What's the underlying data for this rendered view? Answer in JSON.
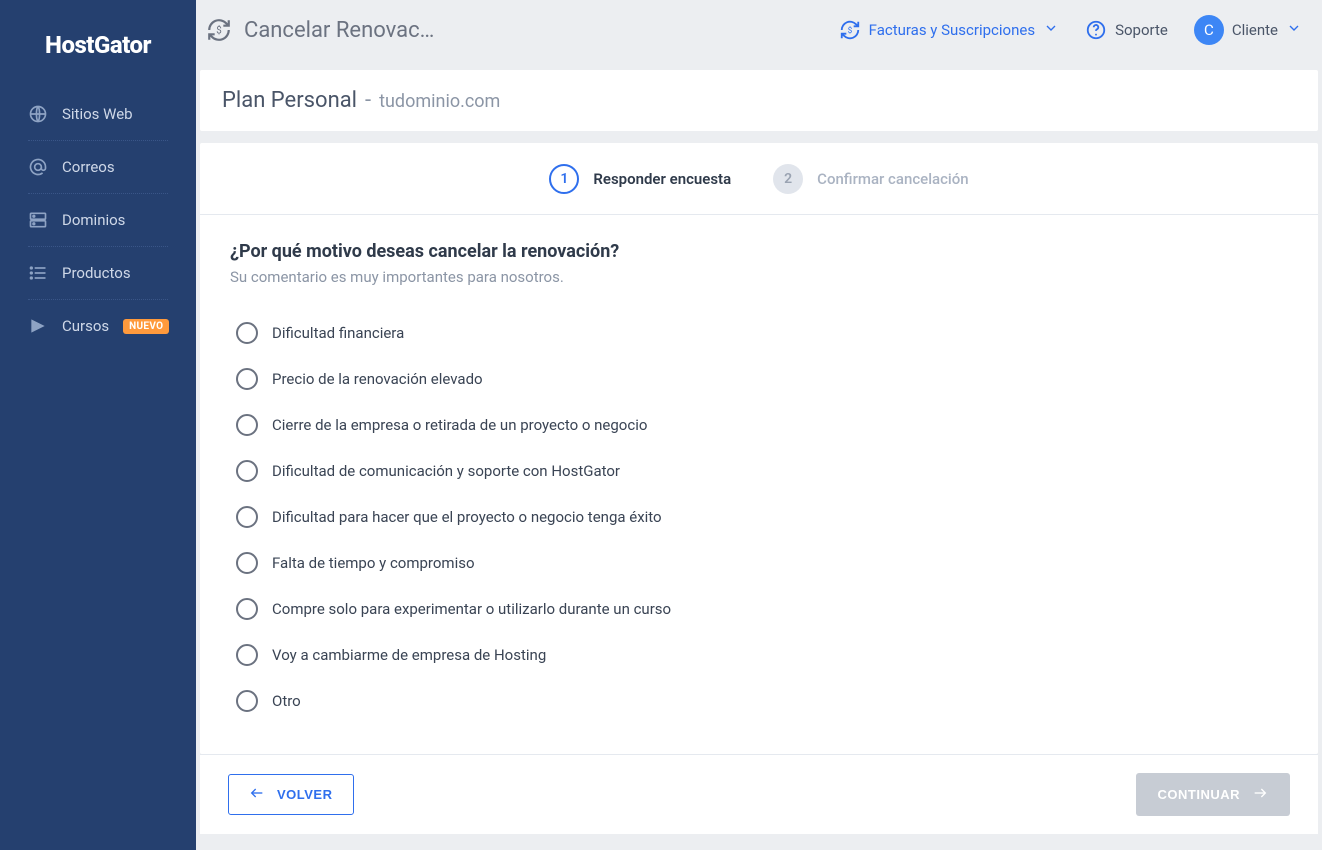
{
  "brand": "HostGator",
  "sidebar": {
    "items": [
      {
        "label": "Sitios Web"
      },
      {
        "label": "Correos"
      },
      {
        "label": "Dominios"
      },
      {
        "label": "Productos"
      },
      {
        "label": "Cursos",
        "badge": "NUEVO"
      }
    ]
  },
  "topbar": {
    "title": "Cancelar Renovac…",
    "links": {
      "invoices": "Facturas y Suscripciones",
      "support": "Soporte",
      "client": "Cliente"
    },
    "avatar_initial": "C"
  },
  "plan": {
    "name": "Plan Personal",
    "domain": "tudominio.com"
  },
  "stepper": {
    "step1": {
      "num": "1",
      "label": "Responder encuesta"
    },
    "step2": {
      "num": "2",
      "label": "Confirmar cancelación"
    }
  },
  "survey": {
    "question": "¿Por qué motivo deseas cancelar la renovación?",
    "subtitle": "Su comentario es muy importantes para nosotros.",
    "options": [
      "Dificultad financiera",
      "Precio de la renovación elevado",
      "Cierre de la empresa o retirada de un proyecto o negocio",
      "Dificultad de comunicación y soporte con HostGator",
      "Dificultad para hacer que el proyecto o negocio tenga éxito",
      "Falta de tiempo y compromiso",
      "Compre solo para experimentar o utilizarlo durante un curso",
      "Voy a cambiarme de empresa de Hosting",
      "Otro"
    ]
  },
  "footer": {
    "back": "VOLVER",
    "next": "CONTINUAR"
  }
}
